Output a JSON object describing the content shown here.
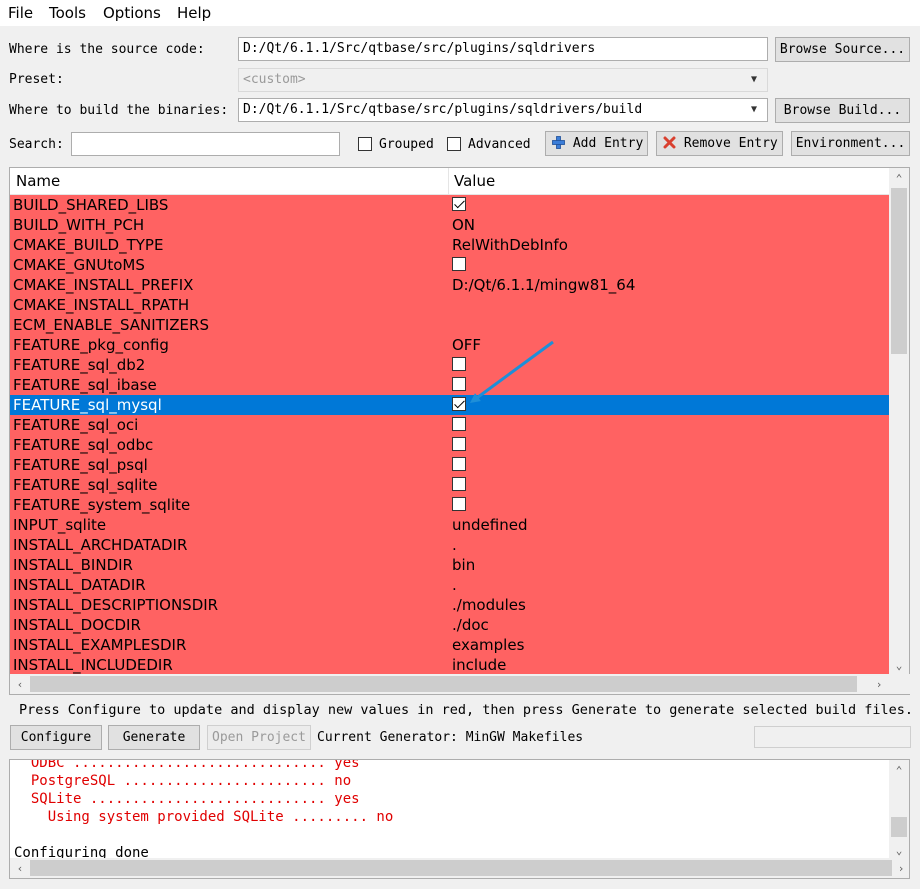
{
  "menu": [
    "File",
    "Tools",
    "Options",
    "Help"
  ],
  "source": {
    "label": "Where is the source code:",
    "value": "D:/Qt/6.1.1/Src/qtbase/src/plugins/sqldrivers",
    "button": "Browse Source..."
  },
  "preset": {
    "label": "Preset:",
    "value": "<custom>"
  },
  "build": {
    "label": "Where to build the binaries:",
    "value": "D:/Qt/6.1.1/Src/qtbase/src/plugins/sqldrivers/build",
    "button": "Browse Build..."
  },
  "search": {
    "label": "Search:",
    "value": ""
  },
  "options": {
    "grouped": "Grouped",
    "advanced": "Advanced"
  },
  "actions": {
    "add_entry": "Add Entry",
    "remove_entry": "Remove Entry",
    "environment": "Environment..."
  },
  "table": {
    "columns": [
      "Name",
      "Value"
    ],
    "rows": [
      {
        "name": "BUILD_SHARED_LIBS",
        "type": "bool",
        "checked": true
      },
      {
        "name": "BUILD_WITH_PCH",
        "value": "ON"
      },
      {
        "name": "CMAKE_BUILD_TYPE",
        "value": "RelWithDebInfo"
      },
      {
        "name": "CMAKE_GNUtoMS",
        "type": "bool",
        "checked": false
      },
      {
        "name": "CMAKE_INSTALL_PREFIX",
        "value": "D:/Qt/6.1.1/mingw81_64"
      },
      {
        "name": "CMAKE_INSTALL_RPATH",
        "value": ""
      },
      {
        "name": "ECM_ENABLE_SANITIZERS",
        "value": ""
      },
      {
        "name": "FEATURE_pkg_config",
        "value": "OFF"
      },
      {
        "name": "FEATURE_sql_db2",
        "type": "bool",
        "checked": false
      },
      {
        "name": "FEATURE_sql_ibase",
        "type": "bool",
        "checked": false
      },
      {
        "name": "FEATURE_sql_mysql",
        "type": "bool",
        "checked": true,
        "selected": true
      },
      {
        "name": "FEATURE_sql_oci",
        "type": "bool",
        "checked": false
      },
      {
        "name": "FEATURE_sql_odbc",
        "type": "bool",
        "checked": false
      },
      {
        "name": "FEATURE_sql_psql",
        "type": "bool",
        "checked": false
      },
      {
        "name": "FEATURE_sql_sqlite",
        "type": "bool",
        "checked": false
      },
      {
        "name": "FEATURE_system_sqlite",
        "type": "bool",
        "checked": false
      },
      {
        "name": "INPUT_sqlite",
        "value": "undefined"
      },
      {
        "name": "INSTALL_ARCHDATADIR",
        "value": "."
      },
      {
        "name": "INSTALL_BINDIR",
        "value": "bin"
      },
      {
        "name": "INSTALL_DATADIR",
        "value": "."
      },
      {
        "name": "INSTALL_DESCRIPTIONSDIR",
        "value": "./modules"
      },
      {
        "name": "INSTALL_DOCDIR",
        "value": "./doc"
      },
      {
        "name": "INSTALL_EXAMPLESDIR",
        "value": "examples"
      },
      {
        "name": "INSTALL_INCLUDEDIR",
        "value": "include"
      }
    ]
  },
  "hint": "Press Configure to update and display new values in red, then press Generate to generate selected build files.",
  "bottom": {
    "configure": "Configure",
    "generate": "Generate",
    "open_project": "Open Project",
    "generator": "Current Generator: MinGW Makefiles"
  },
  "output": [
    {
      "text": "  ODBC .............................. yes",
      "red": true
    },
    {
      "text": "  PostgreSQL ........................ no",
      "red": true
    },
    {
      "text": "  SQLite ............................ yes",
      "red": true
    },
    {
      "text": "    Using system provided SQLite ......... no",
      "red": true
    },
    {
      "text": "",
      "red": false
    },
    {
      "text": "Configuring done",
      "red": false
    }
  ],
  "colors": {
    "changed_row": "#ff6262",
    "selected_row": "#0078d7",
    "annotation_arrow": "#1e8fd8",
    "output_red": "#e00000"
  }
}
